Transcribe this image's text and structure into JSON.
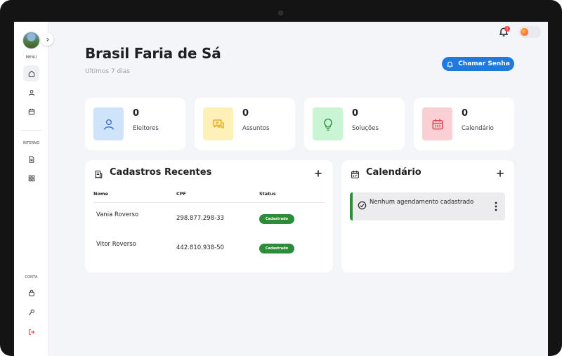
{
  "sidebar": {
    "menu_label": "MENU",
    "interno_label": "INTERNO",
    "conta_label": "CONTA",
    "items": [
      {
        "name": "home",
        "icon": "home-icon",
        "active": true
      },
      {
        "name": "user",
        "icon": "user-icon",
        "active": false
      },
      {
        "name": "calendar",
        "icon": "calendar-icon",
        "active": false
      },
      {
        "name": "document",
        "icon": "document-icon",
        "active": false
      },
      {
        "name": "grid",
        "icon": "grid-icon",
        "active": false
      },
      {
        "name": "lock",
        "icon": "lock-icon",
        "active": false
      },
      {
        "name": "key",
        "icon": "key-icon",
        "active": false
      },
      {
        "name": "logout",
        "icon": "logout-icon",
        "active": false
      }
    ]
  },
  "header": {
    "title": "Brasil Faria de Sá",
    "subtitle": "Ultimos 7 dias",
    "notification_count": "1",
    "cta_label": "Chamar Senha"
  },
  "stats": [
    {
      "value": "0",
      "label": "Eleitores",
      "icon": "user-icon",
      "bg": "#cfe3fb",
      "fg": "#2f6fd6"
    },
    {
      "value": "0",
      "label": "Assuntos",
      "icon": "chat-icon",
      "bg": "#fdf0b8",
      "fg": "#d9a500"
    },
    {
      "value": "0",
      "label": "Soluções",
      "icon": "lightbulb-icon",
      "bg": "#c9f5d4",
      "fg": "#1f8a3b"
    },
    {
      "value": "0",
      "label": "Calendário",
      "icon": "calendar-icon",
      "bg": "#fbd0d5",
      "fg": "#e0394b"
    }
  ],
  "recent": {
    "title": "Cadastros Recentes",
    "columns": [
      "Nome",
      "CPF",
      "Status"
    ],
    "rows": [
      {
        "name": "Vania Roverso",
        "cpf": "298.877.298-33",
        "status": "Cadastrado"
      },
      {
        "name": "Vitor Roverso",
        "cpf": "442.810.938-50",
        "status": "Cadastrado"
      }
    ]
  },
  "calendar": {
    "title": "Calendário",
    "empty_message": "Nenhum agendamento cadastrado"
  },
  "colors": {
    "accent": "#1f7ae0",
    "success": "#2e8b3a",
    "danger": "#e0394b",
    "background": "#f4f5f8"
  }
}
